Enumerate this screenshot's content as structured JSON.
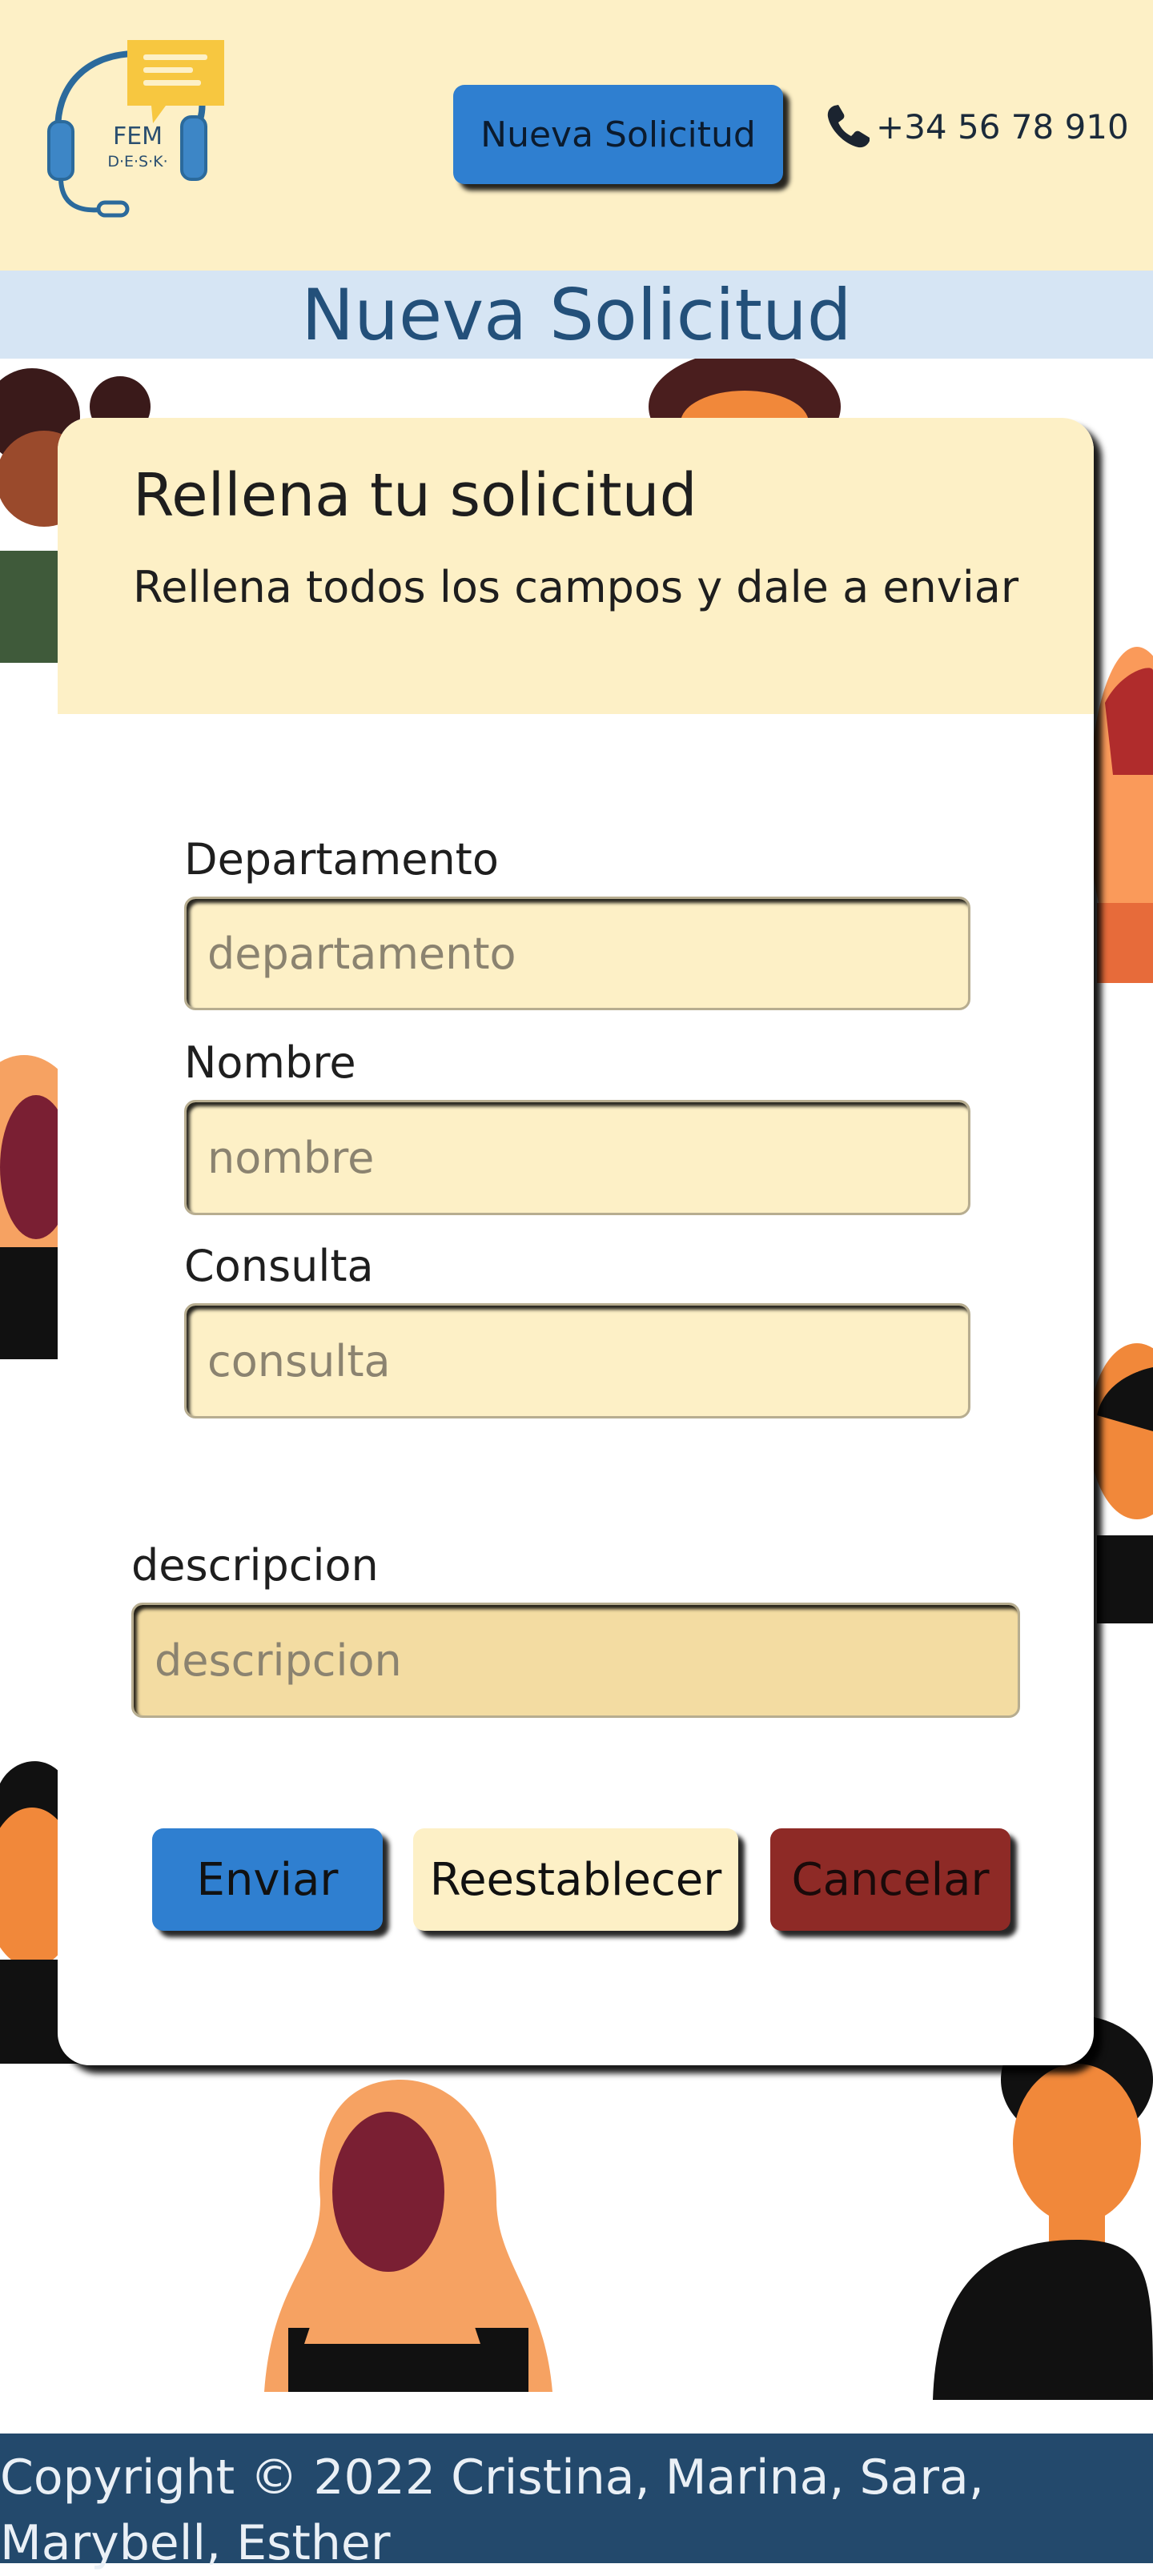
{
  "header": {
    "logo_text_top": "FEM",
    "logo_text_bottom": "D·E·S·K·",
    "new_request_button": "Nueva Solicitud",
    "phone": "+34 56 78 910"
  },
  "page_title": "Nueva Solicitud",
  "card": {
    "title": "Rellena tu solicitud",
    "subtitle": "Rellena todos los campos y dale a enviar"
  },
  "form": {
    "department_label": "Departamento",
    "department_placeholder": "departamento",
    "name_label": "Nombre",
    "name_placeholder": "nombre",
    "query_label": "Consulta",
    "query_placeholder": "consulta",
    "description_label": "descripcion",
    "description_placeholder": "descripcion"
  },
  "buttons": {
    "send": "Enviar",
    "reset": "Reestablecer",
    "cancel": "Cancelar"
  },
  "footer": {
    "copyright": "Copyright © 2022 Cristina, Marina, Sara, Marybell, Esther"
  },
  "colors": {
    "cream": "#fdf0c6",
    "primary_blue": "#2f7fd0",
    "title_blue": "#23507a",
    "footer_navy": "#23496c",
    "cancel_red": "#8e2a26"
  }
}
